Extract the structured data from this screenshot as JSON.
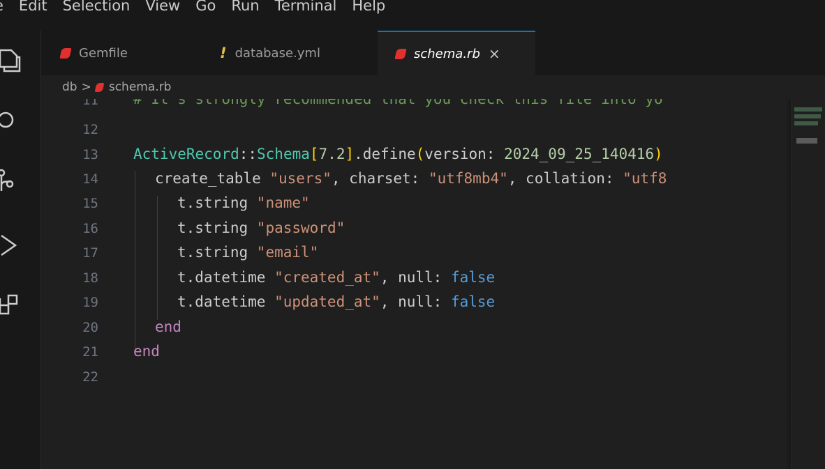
{
  "menu": [
    "e",
    "Edit",
    "Selection",
    "View",
    "Go",
    "Run",
    "Terminal",
    "Help"
  ],
  "tabs": [
    {
      "label": "Gemfile",
      "kind": "ruby",
      "active": false
    },
    {
      "label": "database.yml",
      "kind": "yaml",
      "active": false,
      "icon": "!"
    },
    {
      "label": "schema.rb",
      "kind": "ruby",
      "active": true,
      "close": "×"
    }
  ],
  "breadcrumb": {
    "folder": "db",
    "separator": ">",
    "file": "schema.rb"
  },
  "gutter": [
    "11",
    "12",
    "13",
    "14",
    "15",
    "16",
    "17",
    "18",
    "19",
    "20",
    "21",
    "22"
  ],
  "code": {
    "l11": "# It's strongly recommended that you check this file into yo",
    "l13": {
      "c1": "ActiveRecord",
      "op1": "::",
      "c2": "Schema",
      "b1": "[",
      "n1": "7.2",
      "b2": "]",
      "m": ".define",
      "p1": "(",
      "arg": "version: ",
      "n2": "2024_09_25_140416",
      "p2": ")"
    },
    "l14": {
      "m": "create_table ",
      "s1": "\"users\"",
      "t1": ", charset: ",
      "s2": "\"utf8mb4\"",
      "t2": ", collation: ",
      "s3": "\"utf8"
    },
    "l15": {
      "m": "t.string ",
      "s": "\"name\""
    },
    "l16": {
      "m": "t.string ",
      "s": "\"password\""
    },
    "l17": {
      "m": "t.string ",
      "s": "\"email\""
    },
    "l18": {
      "m": "t.datetime ",
      "s": "\"created_at\"",
      "t": ", null: ",
      "b": "false"
    },
    "l19": {
      "m": "t.datetime ",
      "s": "\"updated_at\"",
      "t": ", null: ",
      "b": "false"
    },
    "l20": "end",
    "l21": "end"
  },
  "colors": {
    "accent": "#0078d4",
    "ruby": "#e0302f",
    "yaml": "#e2c04a"
  }
}
